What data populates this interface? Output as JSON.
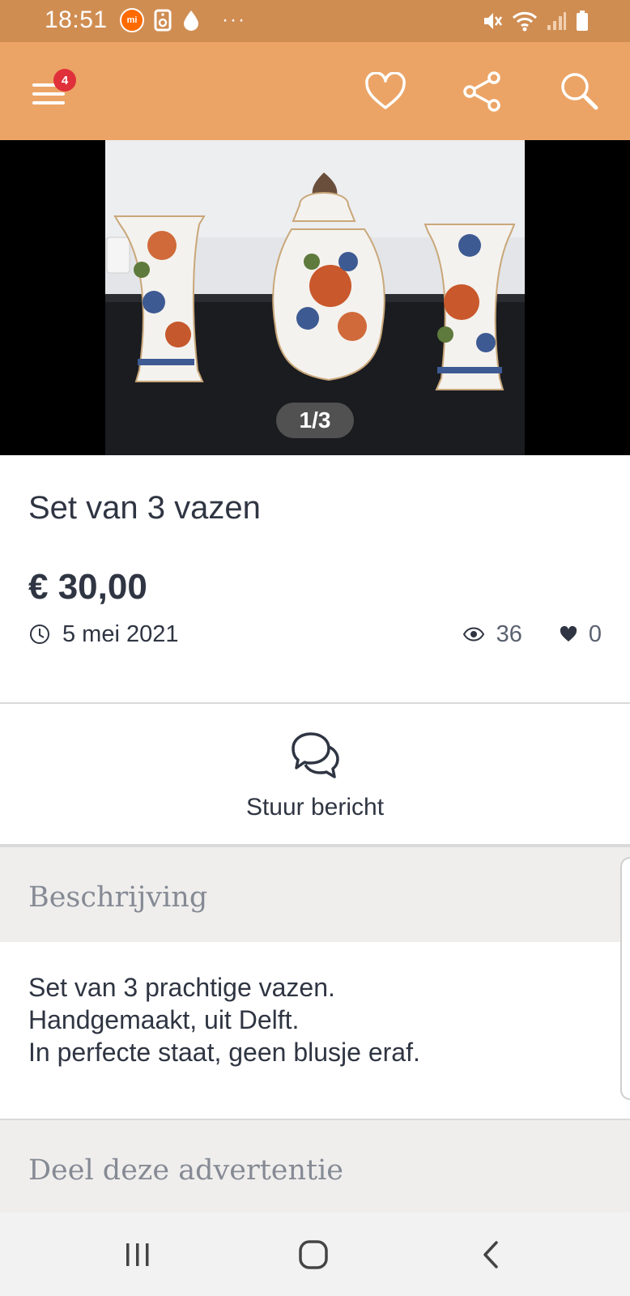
{
  "status_bar": {
    "time": "18:51",
    "mi_label": "mi",
    "dots": "···"
  },
  "app_bar": {
    "menu_badge": "4"
  },
  "gallery": {
    "counter": "1/3"
  },
  "listing": {
    "title": "Set van 3 vazen",
    "price": "€ 30,00",
    "date": "5 mei 2021",
    "views": "36",
    "likes": "0"
  },
  "actions": {
    "message_label": "Stuur bericht"
  },
  "description": {
    "heading": "Beschrijving",
    "lines": [
      "Set van 3 prachtige vazen.",
      "Handgemaakt,  uit Delft.",
      "In perfecte staat, geen blusje eraf."
    ]
  },
  "share": {
    "heading": "Deel deze advertentie"
  },
  "colors": {
    "status_bar": "#d08d52",
    "app_bar": "#eba466",
    "text_primary": "#2f3542",
    "section_bg": "#efeeed",
    "badge": "#e0303a"
  }
}
